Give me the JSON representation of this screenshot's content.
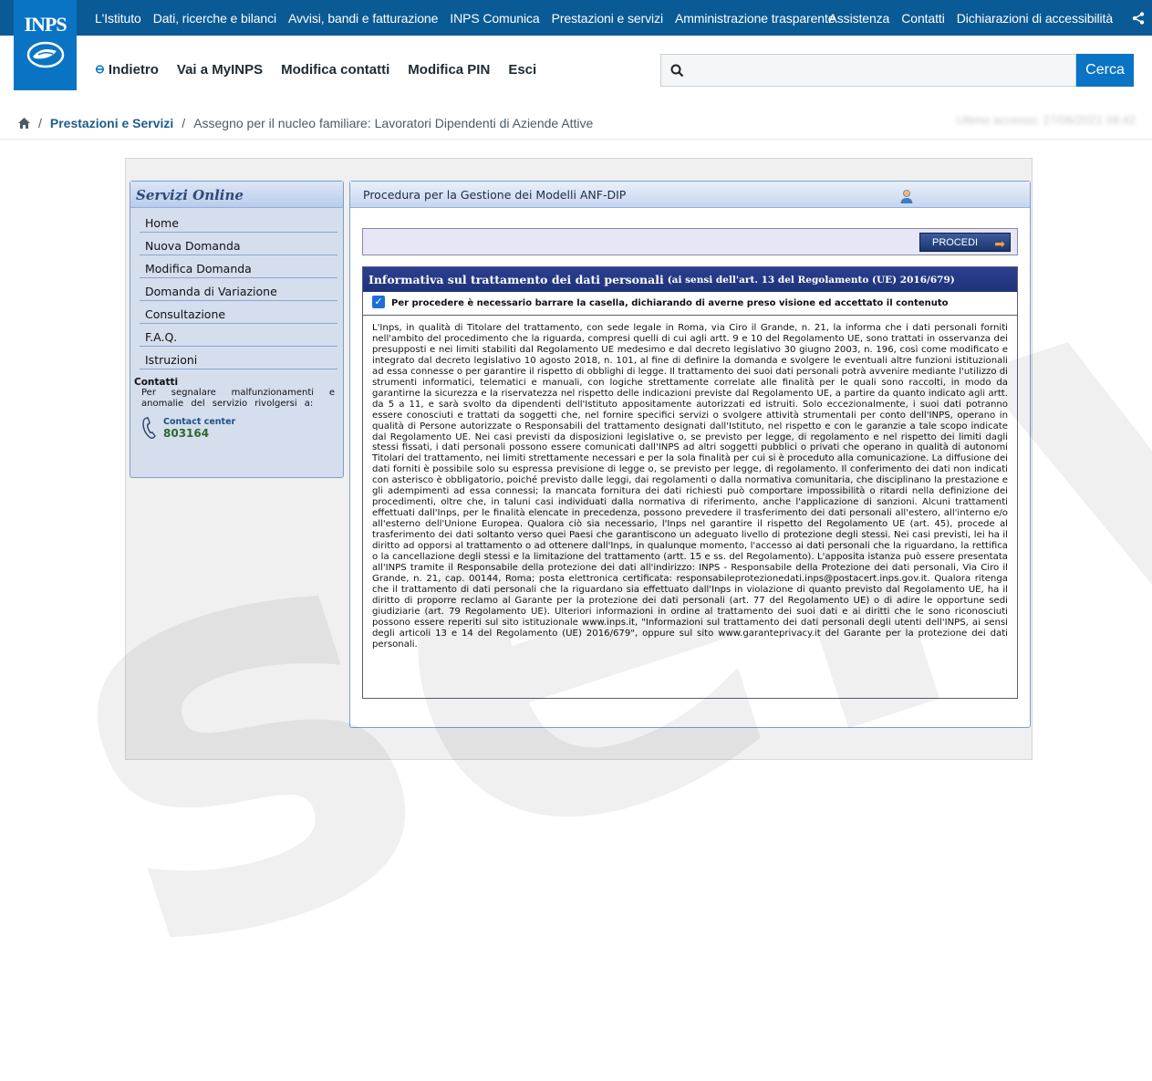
{
  "topnav": {
    "items": [
      "L'Istituto",
      "Dati, ricerche e bilanci",
      "Avvisi, bandi e fatturazione",
      "INPS Comunica",
      "Prestazioni e servizi",
      "Amministrazione trasparente"
    ],
    "right_items": [
      "Assistenza",
      "Contatti",
      "Dichiarazioni di accessibilità"
    ]
  },
  "logo": {
    "text": "INPS"
  },
  "subnav": {
    "back": "Indietro",
    "items": [
      "Vai a MyINPS",
      "Modifica contatti",
      "Modifica PIN",
      "Esci"
    ]
  },
  "search": {
    "button": "Cerca",
    "placeholder": ""
  },
  "breadcrumb": {
    "link": "Prestazioni e Servizi",
    "current": "Assegno per il nucleo familiare: Lavoratori Dipendenti di Aziende Attive",
    "last_access": "Ultimo accesso: 27/06/2021 09:42"
  },
  "sidebar": {
    "title": "Servizi Online",
    "items": [
      "Home",
      "Nuova Domanda",
      "Modifica Domanda",
      "Domanda di Variazione",
      "Consultazione",
      "F.A.Q.",
      "Istruzioni"
    ],
    "contacts_title": "Contatti",
    "contacts_text": "Per segnalare malfunzionamenti e anomalie del servizio rivolgersi a:",
    "cc_label": "Contact center",
    "cc_number": "803164"
  },
  "content": {
    "title": "Procedura per la Gestione dei Modelli ANF-DIP",
    "procedi": "PROCEDI",
    "info_title": "Informativa sul trattamento dei dati personali",
    "info_subtitle": "(ai sensi dell'art. 13 del Regolamento (UE) 2016/679)",
    "checkbox_label": "Per procedere è necessario barrare la casella, dichiarando di averne preso visione ed accettato il contenuto",
    "checkbox_checked": true,
    "body": "L'Inps, in qualità di Titolare del trattamento, con sede legale in Roma, via Ciro il Grande, n. 21, la informa che i dati personali forniti nell'ambito del procedimento che la riguarda, compresi quelli di cui agli artt. 9 e 10 del Regolamento UE, sono trattati in osservanza dei presupposti e nei limiti stabiliti dal Regolamento UE medesimo e dal decreto legislativo 30 giugno 2003, n. 196, così come modificato e integrato dal decreto legislativo 10 agosto 2018, n. 101, al fine di definire la domanda e svolgere le eventuali altre funzioni istituzionali ad essa connesse o per garantire il rispetto di obblighi di legge. Il trattamento dei suoi dati personali potrà avvenire mediante l'utilizzo di strumenti informatici, telematici e manuali, con logiche strettamente correlate alle finalità per le quali sono raccolti, in modo da garantirne la sicurezza e la riservatezza nel rispetto delle indicazioni previste dal Regolamento UE, a partire da quanto indicato agli artt. da 5 a 11, e sarà svolto da dipendenti dell'Istituto appositamente autorizzati ed istruiti. Solo eccezionalmente, i suoi dati potranno essere conosciuti e trattati da soggetti che, nel fornire specifici servizi o svolgere attività strumentali per conto dell'INPS, operano in qualità di Persone autorizzate o Responsabili del trattamento designati dall'Istituto, nel rispetto e con le garanzie a tale scopo indicate dal Regolamento UE. Nei casi previsti da disposizioni legislative o, se previsto per legge, di regolamento e nel rispetto dei limiti dagli stessi fissati, i dati personali possono essere comunicati dall'INPS ad altri soggetti pubblici o privati che operano in qualità di autonomi Titolari del trattamento, nei limiti strettamente necessari e per la sola finalità per cui si è proceduto alla comunicazione. La diffusione dei dati forniti è possibile solo su espressa previsione di legge o, se previsto per legge, di regolamento. Il conferimento dei dati non indicati con asterisco è obbligatorio, poiché previsto dalle leggi, dai regolamenti o dalla normativa comunitaria, che disciplinano la prestazione e gli adempimenti ad essa connessi; la mancata fornitura dei dati richiesti può comportare impossibilità o ritardi nella definizione dei procedimenti, oltre che, in taluni casi individuati dalla normativa di riferimento, anche l'applicazione di sanzioni. Alcuni trattamenti effettuati dall'Inps, per le finalità elencate in precedenza, possono prevedere il trasferimento dei dati personali all'estero, all'interno e/o all'esterno dell'Unione Europea. Qualora ciò sia necessario, l'Inps nel garantire il rispetto del Regolamento UE (art. 45), procede al trasferimento dei dati soltanto verso quei Paesi che garantiscono un adeguato livello di protezione degli stessi. Nei casi previsti, lei ha il diritto ad opporsi al trattamento o ad ottenere dall'Inps, in qualunque momento, l'accesso ai dati personali che la riguardano, la rettifica o la cancellazione degli stessi e la limitazione del trattamento (artt. 15 e ss. del Regolamento). L'apposita istanza può essere presentata all'INPS tramite il Responsabile della protezione dei dati all'indirizzo: INPS - Responsabile della Protezione dei dati personali, Via Ciro il Grande, n. 21, cap. 00144, Roma; posta elettronica certificata: responsabileprotezionedati.inps@postacert.inps.gov.it. Qualora ritenga che il trattamento di dati personali che la riguardano sia effettuato dall'Inps in violazione di quanto previsto dal Regolamento UE, ha il diritto di proporre reclamo al Garante per la protezione dei dati personali (art. 77 del Regolamento UE) o di adire le opportune sedi giudiziarie (art. 79 Regolamento UE). Ulteriori informazioni in ordine al trattamento dei suoi dati e ai diritti che le sono riconosciuti possono essere reperiti sul sito istituzionale www.inps.it, \"Informazioni sul trattamento dei dati personali degli utenti dell'INPS, ai sensi degli articoli 13 e 14 del Regolamento (UE) 2016/679\", oppure sul sito www.garanteprivacy.it del Garante per la protezione dei dati personali."
  },
  "watermark": {
    "text": "servizi.it"
  },
  "colors": {
    "brand_blue": "#0a5a95",
    "accent": "#0a74c4"
  }
}
